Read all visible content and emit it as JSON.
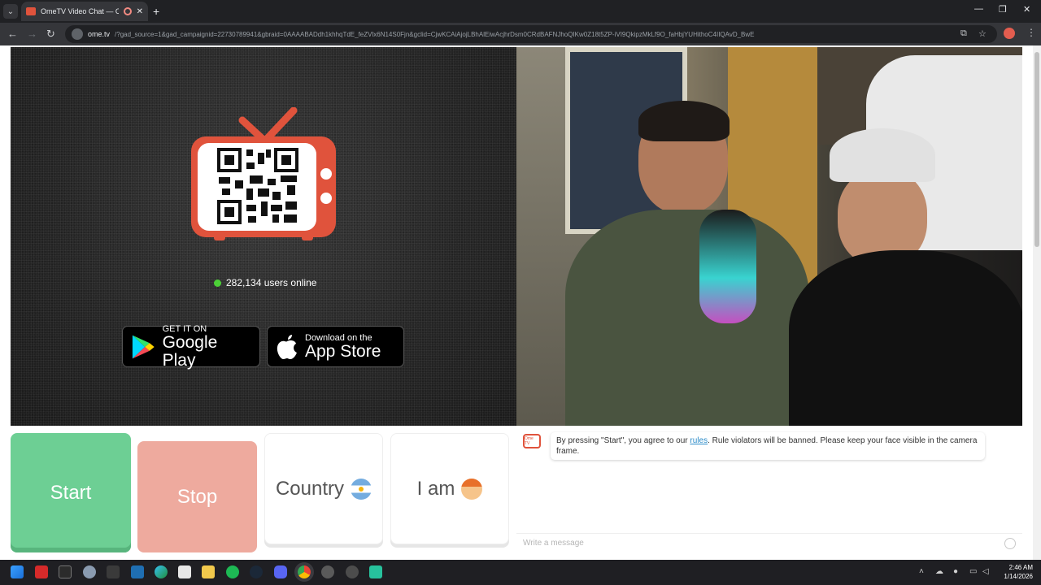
{
  "browser": {
    "tab_title": "OmeTV Video Chat — Ome",
    "tab_close": "✕",
    "new_tab": "+",
    "url_host": "ome.tv",
    "url_rest": "/?gad_source=1&gad_campaignid=22730789941&gbraid=0AAAABADdh1khhqTdE_feZVlx6N14S0Fjn&gclid=CjwKCAiAjojLBhAlEiwAcjhrDsm0CRdBAFNJhoQIKw0Z18t5ZP-iVI9QkipzMkLf9O_faHbjYUHithoC4IIQAvD_BwE",
    "window_controls": [
      "—",
      "❐",
      "✕"
    ]
  },
  "left": {
    "users_online": "282,134 users online",
    "google_play": {
      "small": "GET IT ON",
      "big": "Google Play"
    },
    "app_store": {
      "small": "Download on the",
      "big": "App Store"
    }
  },
  "controls": {
    "start": "Start",
    "stop": "Stop",
    "country": "Country",
    "iam": "I am"
  },
  "chat": {
    "avatar_text": "Ome TV",
    "msg_before": "By pressing \"Start\", you agree to our ",
    "msg_link": "rules",
    "msg_after": ". Rule violators will be banned. Please keep your face visible in the camera frame.",
    "input_placeholder": "Write a message"
  },
  "taskbar": {
    "time": "2:46 AM",
    "date": "1/14/2026"
  },
  "colors": {
    "start": "#6dcf94",
    "stop": "#eeaa9e",
    "brand": "#e0533c",
    "online_dot": "#4cd137"
  }
}
